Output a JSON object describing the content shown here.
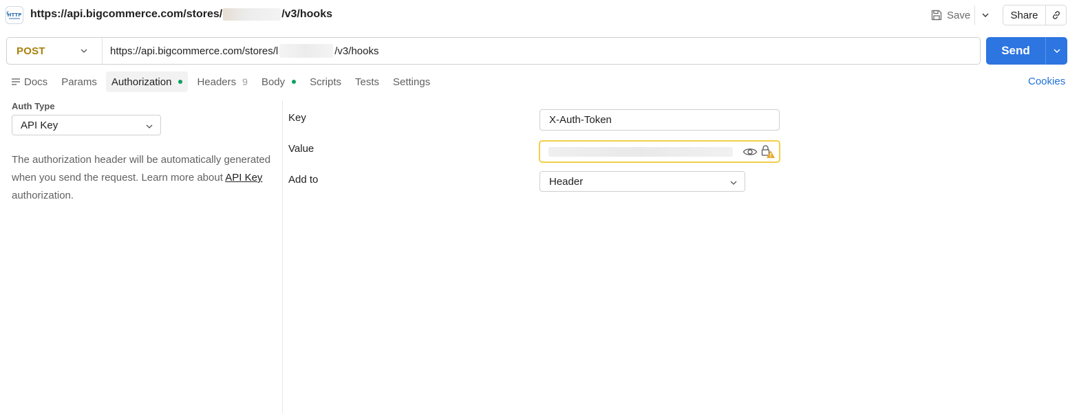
{
  "header": {
    "protocol_icon_label": "HTTP",
    "url_prefix": "https://api.bigcommerce.com/stores/",
    "url_suffix": "/v3/hooks",
    "save_label": "Save",
    "share_label": "Share"
  },
  "request": {
    "method": "POST",
    "url_prefix": "https://api.bigcommerce.com/stores/l",
    "url_suffix": "/v3/hooks",
    "send_label": "Send",
    "method_color": "#a8800b",
    "send_color": "#2d75e0"
  },
  "tabs": [
    {
      "label": "Docs",
      "icon": "docs-icon"
    },
    {
      "label": "Params"
    },
    {
      "label": "Authorization",
      "active": true,
      "indicator": "dot"
    },
    {
      "label": "Headers",
      "count": "9"
    },
    {
      "label": "Body",
      "indicator": "dot"
    },
    {
      "label": "Scripts"
    },
    {
      "label": "Tests"
    },
    {
      "label": "Settings"
    }
  ],
  "cookies_label": "Cookies",
  "auth": {
    "type_label": "Auth Type",
    "type_value": "API Key",
    "desc_part1": "The authorization header will be automatically generated when you send the request. Learn more about ",
    "desc_link": "API Key",
    "desc_part2": " authorization."
  },
  "form": {
    "key_label": "Key",
    "key_value": "X-Auth-Token",
    "value_label": "Value",
    "addto_label": "Add to",
    "addto_value": "Header",
    "warning_color": "#f2cf4a"
  }
}
